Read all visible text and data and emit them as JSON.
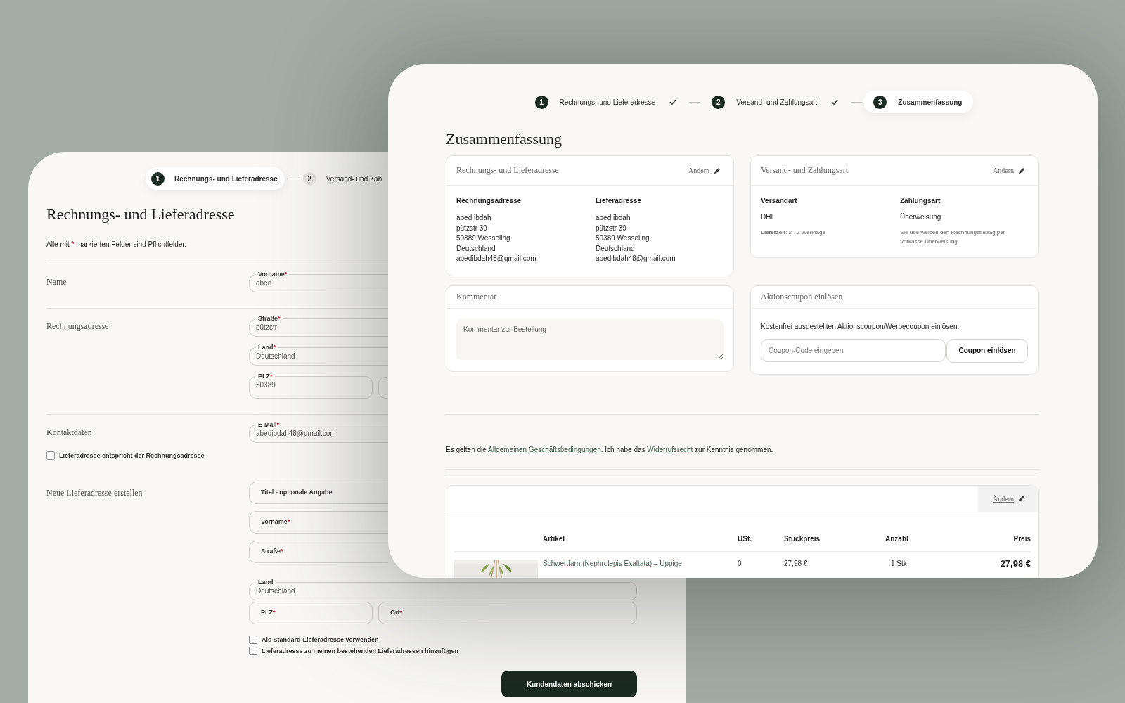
{
  "back_window": {
    "stepper": [
      {
        "number": "1",
        "label": "Rechnungs- und Lieferadresse",
        "selected": true,
        "done": false
      },
      {
        "number": "2",
        "label": "Versand- und Zah",
        "selected": false,
        "done": false
      }
    ],
    "title": "Rechnungs- und Lieferadresse",
    "required_note": {
      "before": "Alle mit",
      "mark": "*",
      "after": "markierten Felder sind Pflichtfelder."
    },
    "sections": [
      {
        "title": "Name",
        "rows": [
          [
            {
              "kind": "filled",
              "label": "Vorname",
              "required_mark": "*",
              "value": "abed"
            }
          ]
        ]
      },
      {
        "title": "Rechnungsadresse",
        "rows": [
          [
            {
              "kind": "filled",
              "label": "Straße",
              "required_mark": "*",
              "value": "pützstr"
            }
          ],
          [
            {
              "kind": "filled",
              "label": "Land",
              "required_mark": "*",
              "value": "Deutschland"
            }
          ],
          [
            {
              "kind": "filled",
              "label": "PLZ",
              "required_mark": "*",
              "value": "50389"
            },
            {
              "kind": "blank"
            }
          ]
        ]
      },
      {
        "title": "Kontaktdaten",
        "rows": [
          [
            {
              "kind": "filled",
              "label": "E-Mail",
              "required_mark": "*",
              "value": "abedibdah48@gmail.com"
            }
          ]
        ],
        "wide_checkbox": {
          "label": "Lieferadresse entspricht der Rechnungsadresse",
          "checked": false
        }
      },
      {
        "title": "Neue Lieferadresse erstellen",
        "rows": [
          [
            {
              "kind": "empty",
              "label": "Titel - optionale Angabe"
            }
          ],
          [
            {
              "kind": "empty",
              "label": "Vorname",
              "required_mark": "*"
            }
          ],
          [
            {
              "kind": "empty",
              "label": "Straße",
              "required_mark": "*"
            }
          ],
          [
            {
              "kind": "filled",
              "label": "Land",
              "value": "Deutschland"
            }
          ],
          [
            {
              "kind": "empty",
              "label": "PLZ",
              "required_mark": "*"
            },
            {
              "kind": "empty",
              "label": "Ort",
              "required_mark": "*"
            }
          ]
        ],
        "checkboxes": [
          {
            "label": "Als Standard-Lieferadresse verwenden",
            "checked": false
          },
          {
            "label": "Lieferadresse zu meinen bestehenden Lieferadressen hinzufügen",
            "checked": false
          }
        ]
      }
    ],
    "submit_button": "Kundendaten abschicken"
  },
  "front_window": {
    "stepper": [
      {
        "number": "1",
        "label": "Rechnungs- und Lieferadresse",
        "selected": false,
        "done": true
      },
      {
        "number": "2",
        "label": "Versand- und Zahlungsart",
        "selected": false,
        "done": true
      },
      {
        "number": "3",
        "label": "Zusammenfassung",
        "selected": true,
        "done": false
      }
    ],
    "title": "Zusammenfassung",
    "address_card": {
      "title": "Rechnungs- und Lieferadresse",
      "edit_link": "Ändern",
      "columns": [
        {
          "heading": "Rechnungsadresse",
          "lines": [
            "abed ibdah",
            "pützstr 39",
            "50389 Wesseling",
            "Deutschland",
            "abedibdah48@gmail.com"
          ]
        },
        {
          "heading": "Lieferadresse",
          "lines": [
            "abed ibdah",
            "pützstr 39",
            "50389 Wesseling",
            "Deutschland",
            "abedibdah48@gmail.com"
          ]
        }
      ]
    },
    "shipping_card": {
      "title": "Versand- und Zahlungsart",
      "edit_link": "Ändern",
      "columns": [
        {
          "heading": "Versandart",
          "value": "DHL",
          "note": "**Lieferzeit**: 2 - 3 Werktage"
        },
        {
          "heading": "Zahlungsart",
          "value": "Überweisung",
          "note": "Sie überweisen den Rechnungsbetrag per Vorkasse Überweisung."
        }
      ]
    },
    "comment_card": {
      "title": "Kommentar",
      "placeholder": "Kommentar zur Bestellung"
    },
    "coupon_card": {
      "title": "Aktionscoupon einlösen",
      "text": "Kostenfrei ausgestellten Aktionscoupon/Werbecoupon einlösen.",
      "placeholder": "Coupon-Code eingeben",
      "button": "Coupon einlösen"
    },
    "legal": {
      "before": "Es gelten die ",
      "link_1": "Allgemeinen Geschäftsbedingungen",
      "middle": ". Ich habe das ",
      "link_2": "Widerrufsrecht",
      "after": " zur Kenntnis genommen."
    },
    "items": {
      "edit_link": "Ändern",
      "columns": [
        "Artikel",
        "USt.",
        "Stückpreis",
        "Anzahl",
        "Preis"
      ],
      "rows": [
        {
          "name": "Schwertfarn (Nephrolepis Exaltata) – Üppige",
          "vat": "0",
          "unit_price": "27,98 €",
          "quantity": "1 Stk",
          "price": "27,98 €"
        }
      ]
    }
  }
}
